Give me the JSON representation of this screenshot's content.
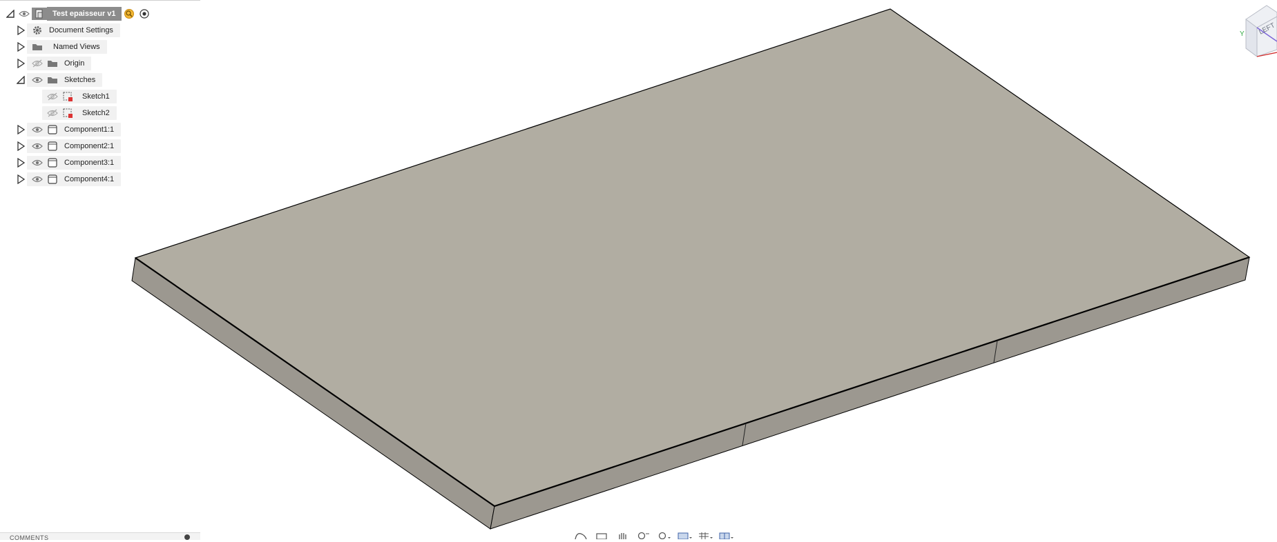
{
  "browser": {
    "root": {
      "label": "Test epaisseur v1"
    },
    "items": [
      {
        "label": "Document Settings",
        "icon": "gear-icon"
      },
      {
        "label": "Named Views",
        "icon": "folder-icon"
      },
      {
        "label": "Origin",
        "icon": "folder-icon",
        "visibility": "hidden"
      },
      {
        "label": "Sketches",
        "icon": "folder-icon",
        "visibility": "visible"
      },
      {
        "label": "Sketch1",
        "icon": "sketch-icon",
        "visibility": "hidden"
      },
      {
        "label": "Sketch2",
        "icon": "sketch-icon",
        "visibility": "hidden"
      },
      {
        "label": "Component1:1",
        "icon": "component-icon",
        "visibility": "visible"
      },
      {
        "label": "Component2:1",
        "icon": "component-icon",
        "visibility": "visible"
      },
      {
        "label": "Component3:1",
        "icon": "component-icon",
        "visibility": "visible"
      },
      {
        "label": "Component4:1",
        "icon": "component-icon",
        "visibility": "visible"
      }
    ]
  },
  "comments_panel": {
    "label": "COMMENTS"
  },
  "viewcube": {
    "face_label": "LEFT",
    "axis_label": "Y"
  },
  "colors": {
    "top_face": "#b1ada2",
    "side_face": "#9c9890",
    "edge": "#000000",
    "panel_bg": "#f1f1f1",
    "root_highlight": "#8c8c8c"
  }
}
